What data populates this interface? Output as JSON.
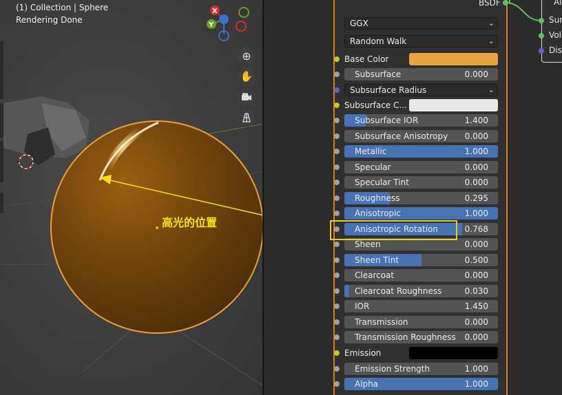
{
  "viewport": {
    "object_path": "(1) Collection | Sphere",
    "render_status": "Rendering Done",
    "gizmo": {
      "x_label": "X",
      "y_label": "Y"
    },
    "annotation": "高光的位置",
    "selection_color": "#f0a030"
  },
  "node": {
    "output_label": "BSDF",
    "distribution": "GGX",
    "subsurface_method": "Random Walk",
    "base_color": {
      "label": "Base Color",
      "swatch": "#e8a23e"
    },
    "subsurface": {
      "label": "Subsurface",
      "value": "0.000"
    },
    "subsurface_radius": {
      "label": "Subsurface Radius"
    },
    "subsurface_color": {
      "label": "Subsurface C...",
      "swatch": "#e8e8e8"
    },
    "sliders": [
      {
        "label": "Subsurface IOR",
        "value": "1.400",
        "fill": 0.14
      },
      {
        "label": "Subsurface Anisotropy",
        "value": "0.000",
        "fill": 0
      },
      {
        "label": "Metallic",
        "value": "1.000",
        "fill": 1
      },
      {
        "label": "Specular",
        "value": "0.000",
        "fill": 0
      },
      {
        "label": "Specular Tint",
        "value": "0.000",
        "fill": 0
      },
      {
        "label": "Roughness",
        "value": "0.295",
        "fill": 0.295
      },
      {
        "label": "Anisotropic",
        "value": "1.000",
        "fill": 1
      },
      {
        "label": "Anisotropic Rotation",
        "value": "0.768",
        "fill": 0.768
      },
      {
        "label": "Sheen",
        "value": "0.000",
        "fill": 0
      },
      {
        "label": "Sheen Tint",
        "value": "0.500",
        "fill": 0.5
      },
      {
        "label": "Clearcoat",
        "value": "0.000",
        "fill": 0
      },
      {
        "label": "Clearcoat Roughness",
        "value": "0.030",
        "fill": 0.03
      },
      {
        "label": "IOR",
        "value": "1.450",
        "fill": 0
      },
      {
        "label": "Transmission",
        "value": "0.000",
        "fill": 0
      },
      {
        "label": "Transmission Roughness",
        "value": "0.000",
        "fill": 0
      }
    ],
    "emission": {
      "label": "Emission",
      "swatch": "#000000"
    },
    "emission_strength": {
      "label": "Emission Strength",
      "value": "1.000",
      "fill": 0
    },
    "alpha": {
      "label": "Alpha",
      "value": "1.000",
      "fill": 1
    }
  },
  "output_node": {
    "title": "All",
    "sockets": [
      "Surf",
      "Volu",
      "Disp"
    ]
  },
  "colors": {
    "accent_blue": "#4772b3",
    "annotation_yellow": "#f4e21a",
    "node_border": "#e07a1a"
  }
}
